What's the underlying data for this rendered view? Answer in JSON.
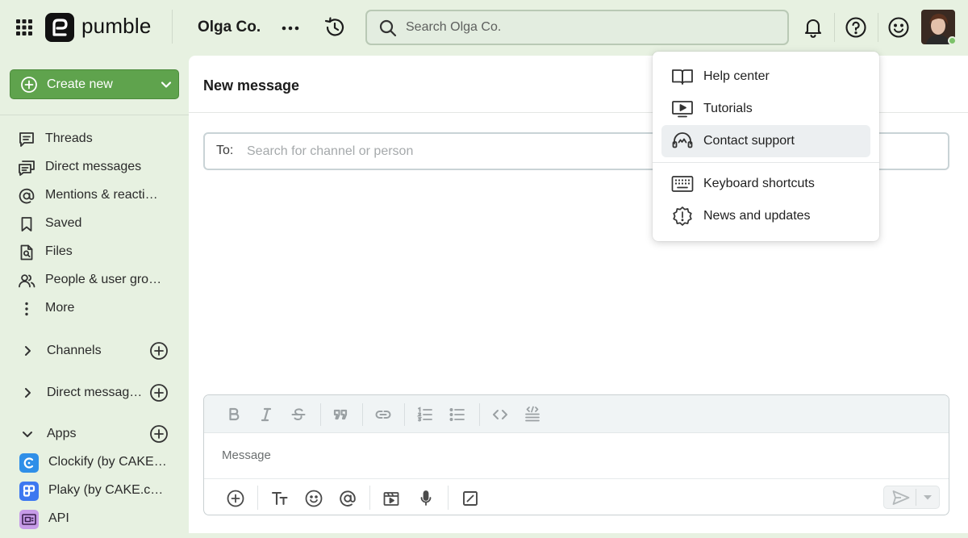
{
  "app": {
    "brand": "pumble"
  },
  "header": {
    "workspace_name": "Olga Co.",
    "search_placeholder": "Search Olga Co."
  },
  "sidebar": {
    "create_new_label": "Create new",
    "nav": [
      {
        "label": "Threads",
        "icon": "threads-icon"
      },
      {
        "label": "Direct messages",
        "icon": "direct-messages-icon"
      },
      {
        "label": "Mentions & reacti…",
        "icon": "at-icon"
      },
      {
        "label": "Saved",
        "icon": "bookmark-icon"
      },
      {
        "label": "Files",
        "icon": "file-search-icon"
      },
      {
        "label": "People & user gro…",
        "icon": "people-icon"
      },
      {
        "label": "More",
        "icon": "more-vertical-icon"
      }
    ],
    "sections": [
      {
        "label": "Channels",
        "expanded": false
      },
      {
        "label": "Direct messag…",
        "expanded": false
      },
      {
        "label": "Apps",
        "expanded": true
      }
    ],
    "apps": [
      {
        "label": "Clockify (by CAKE…",
        "color": "#2f8fe8"
      },
      {
        "label": "Plaky (by CAKE.c…",
        "color": "#3d78f0"
      },
      {
        "label": "API",
        "color": "#c79ce8"
      }
    ]
  },
  "main": {
    "title": "New message",
    "to_label": "To:",
    "to_placeholder": "Search for channel or person",
    "message_placeholder": "Message"
  },
  "help_menu": {
    "items": [
      {
        "label": "Help center",
        "icon": "book-icon",
        "active": false
      },
      {
        "label": "Tutorials",
        "icon": "video-tutorial-icon",
        "active": false
      },
      {
        "label": "Contact support",
        "icon": "headset-icon",
        "active": true
      },
      {
        "label": "Keyboard shortcuts",
        "icon": "keyboard-icon",
        "active": false
      },
      {
        "label": "News and updates",
        "icon": "news-badge-icon",
        "active": false
      }
    ]
  },
  "colors": {
    "background": "#e7f1e1",
    "accent_green": "#5fa34d",
    "online_status": "#7cc26a"
  }
}
